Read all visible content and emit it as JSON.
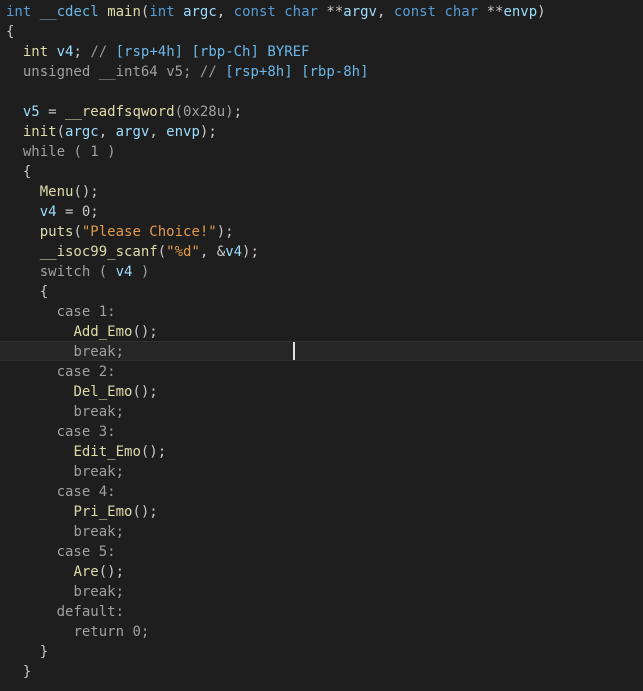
{
  "signature": {
    "ret_type": "int",
    "callconv": "__cdecl",
    "func_name": "main",
    "open_paren": "(",
    "p1_type": "int",
    "p1_name": "argc",
    "sep1": ", ",
    "p2_const": "const",
    "p2_type": "char",
    "p2_stars": "**",
    "p2_name": "argv",
    "sep2": ", ",
    "p3_const": "const",
    "p3_type": "char",
    "p3_stars": "**",
    "p3_name": "envp",
    "close_paren": ")"
  },
  "braces": {
    "open": "{",
    "close": "}"
  },
  "decl_v4": {
    "type": "int",
    "name": "v4",
    "semi": ";",
    "comment_prefix": "// ",
    "comment": "[rsp+4h] [rbp-Ch] BYREF"
  },
  "decl_v5": {
    "type_unsigned": "unsigned",
    "type": "__int64",
    "name": "v5",
    "semi": ";",
    "comment_prefix": "// ",
    "comment": "[rsp+8h] [rbp-8h]"
  },
  "stmt_v5": {
    "name": "v5",
    "assign": " = ",
    "func": "__readfsqword",
    "arg": "(0x28u)",
    "semi": ";"
  },
  "stmt_init": {
    "func": "init",
    "open": "(",
    "a1": "argc",
    "sep1": ", ",
    "a2": "argv",
    "sep2": ", ",
    "a3": "envp",
    "close": ");"
  },
  "loop": {
    "keyword": "while",
    "cond": " ( 1 )"
  },
  "stmt_menu": {
    "func": "Menu",
    "call": "();"
  },
  "stmt_v4_zero": {
    "name": "v4",
    "assign": " = 0;"
  },
  "stmt_puts": {
    "func": "puts",
    "open": "(",
    "str": "\"Please Choice!\"",
    "close": ");"
  },
  "stmt_scanf": {
    "func": "__isoc99_scanf",
    "open": "(",
    "fmt": "\"%d\"",
    "sep": ", &",
    "arg": "v4",
    "close": ");"
  },
  "switch": {
    "keyword": "switch",
    "open": " ( ",
    "var": "v4",
    "close": " )"
  },
  "cases": [
    {
      "label": "case 1:",
      "func": "Add_Emo",
      "call": "();",
      "brk": "break;"
    },
    {
      "label": "case 2:",
      "func": "Del_Emo",
      "call": "();",
      "brk": "break;"
    },
    {
      "label": "case 3:",
      "func": "Edit_Emo",
      "call": "();",
      "brk": "break;"
    },
    {
      "label": "case 4:",
      "func": "Pri_Emo",
      "call": "();",
      "brk": "break;"
    },
    {
      "label": "case 5:",
      "func": "Are",
      "call": "();",
      "brk": "break;"
    }
  ],
  "default_case": {
    "label": "default:",
    "ret_kw": "return",
    "ret_val": " 0;"
  },
  "colors": {
    "background": "#1e1e1e",
    "current_line": "#262626",
    "keyword": "#569cd6",
    "function": "#dcdcaa",
    "variable": "#9cdcfe",
    "string": "#e09a4a",
    "comment": "#9a9a9a"
  }
}
